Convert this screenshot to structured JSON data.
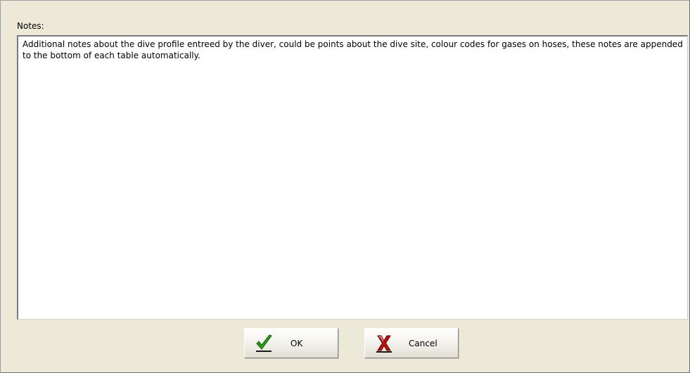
{
  "notes": {
    "label": "Notes:",
    "value": "Additional notes about the dive profile entreed by the diver, could be points about the dive site, colour codes for gases on hoses, these notes are appended to the bottom of each table automatically."
  },
  "buttons": {
    "ok": {
      "label": "OK",
      "icon": "check-icon",
      "icon_color": "#2e9b1f"
    },
    "cancel": {
      "label": "Cancel",
      "icon": "x-icon",
      "icon_color": "#c01010"
    }
  }
}
